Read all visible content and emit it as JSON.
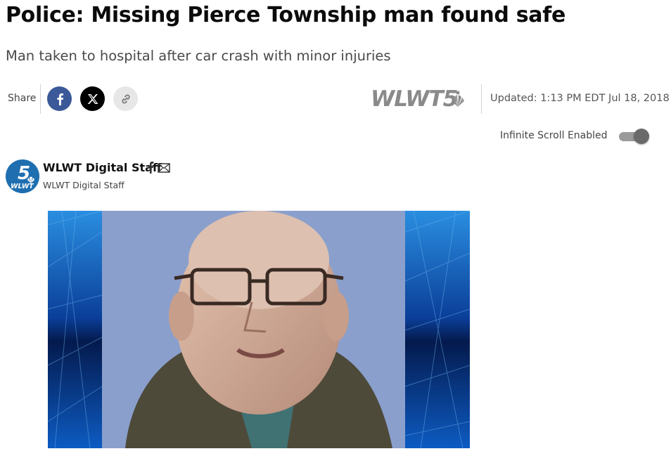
{
  "article": {
    "headline": "Police: Missing Pierce Township man found safe",
    "subheadline": "Man taken to hospital after car crash with minor injuries"
  },
  "share": {
    "label": "Share",
    "buttons": [
      {
        "network": "facebook",
        "icon": "facebook-icon",
        "color": "#3b5998"
      },
      {
        "network": "x",
        "icon": "x-icon",
        "color": "#000000"
      },
      {
        "network": "copy-link",
        "icon": "link-icon",
        "color": "#e7e7e7"
      }
    ]
  },
  "station": {
    "logo_text": "WLWT5",
    "logo_color": "#8a8a8a",
    "updated": "Updated: 1:13 PM EDT Jul 18, 2018"
  },
  "infinite_scroll": {
    "label": "Infinite Scroll Enabled",
    "enabled": true
  },
  "author": {
    "name": "WLWT Digital Staff",
    "role": "WLWT Digital Staff",
    "avatar_color": "#1f6fb0",
    "avatar_text": "WLWT",
    "avatar_number": "5",
    "contact_icons": [
      "facebook-icon",
      "mail-icon"
    ]
  },
  "media": {
    "image": "photo of missing man in glasses with blue triangular background",
    "frame_color": "#0a3a8a",
    "photo_bg": "#8a9fcc"
  }
}
